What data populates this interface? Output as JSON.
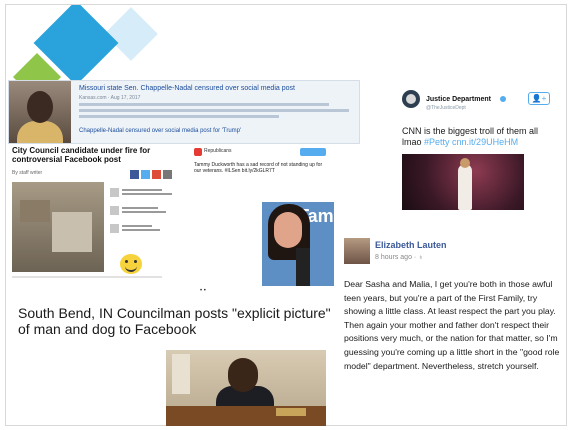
{
  "graphic": {
    "text": ""
  },
  "search_panel": {
    "title": "Missouri state Sen. Chappelle-Nadal censured over social media post",
    "meta": "Kansas.com · Aug 17, 2017",
    "link": "Chappelle-Nadal censured over social media post for 'Trump'"
  },
  "article1": {
    "title": "City Council candidate under fire for controversial Facebook post",
    "byline": "By staff writer"
  },
  "tw_card": {
    "account": "Republicans",
    "text": "Tammy Duckworth has a sad record of not standing up for our veterans. #ILSen bit.ly/2kGLR7T",
    "sign_text": "Tam"
  },
  "south_bend": {
    "headline": "South Bend, IN Councilman posts \"explicit picture\" of man and dog to Facebook",
    "dots": "• •"
  },
  "justice_tweet": {
    "name": "Justice Department",
    "handle": "@TheJusticeDept",
    "follow_icon": "👤+",
    "text": "CNN is the biggest troll of them all lmao",
    "tags": "#Petty cnn.it/29UHeHM"
  },
  "fb_post": {
    "name": "Elizabeth Lauten",
    "meta": "8 hours ago · ♁",
    "text": "Dear Sasha and Malia, I get you're  both in those awful teen years, but you're a part of the First Family, try showing a little class. At least respect the part you play. Then again your mother and father don't respect their positions very much, or the nation for that matter, so I'm guessing you're coming up a little short in the \"good role model\" department. Nevertheless, stretch yourself."
  },
  "colors": {
    "twitter_blue": "#55acee",
    "facebook_blue": "#3b5998",
    "link_blue": "#1a4c9a"
  }
}
